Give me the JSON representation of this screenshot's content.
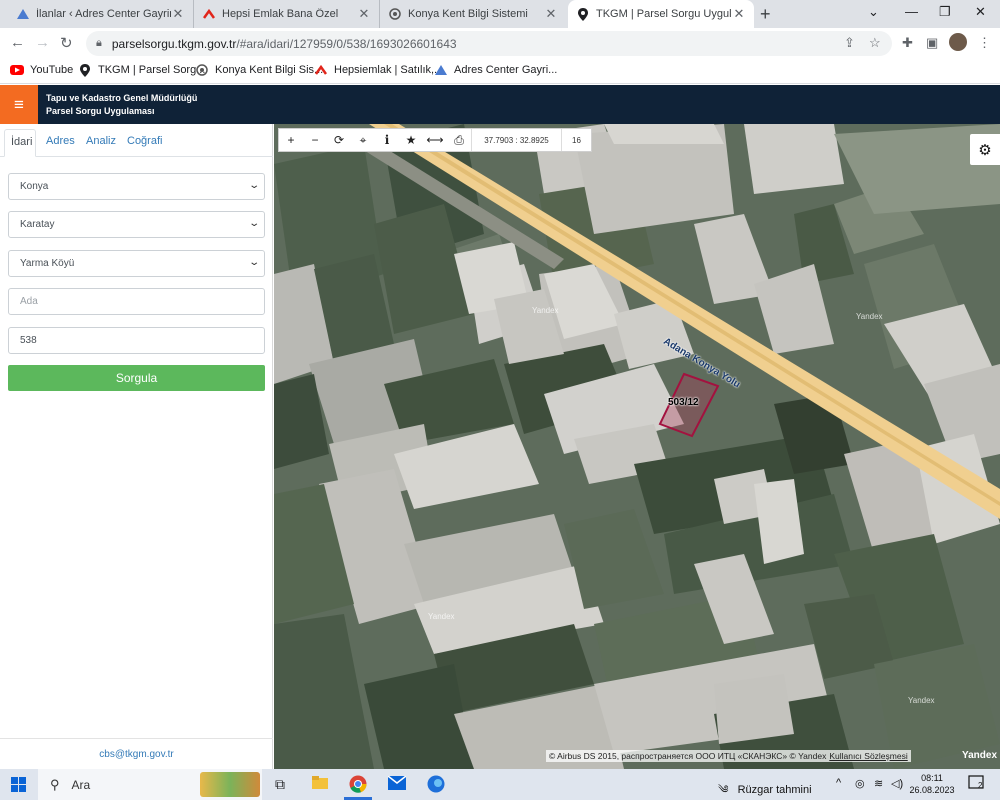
{
  "browser": {
    "tabs": [
      {
        "title": "İlanlar ‹ Adres Center Gayrimenkul",
        "icon": "adres-center-icon",
        "active": false
      },
      {
        "title": "Hepsi Emlak Bana Özel",
        "icon": "hepsiemlak-icon",
        "active": false
      },
      {
        "title": "Konya Kent Bilgi Sistemi",
        "icon": "konya-kbs-icon",
        "active": false
      },
      {
        "title": "TKGM | Parsel Sorgu Uygulaması",
        "icon": "map-pin-icon",
        "active": true
      }
    ],
    "url_domain": "parselsorgu.tkgm.gov.tr",
    "url_path": "/#ara/idari/127959/0/538/1693026601643",
    "bookmarks": [
      {
        "label": "YouTube",
        "icon": "youtube-icon"
      },
      {
        "label": "TKGM | Parsel Sorg...",
        "icon": "map-pin-icon"
      },
      {
        "label": "Konya Kent Bilgi Sis...",
        "icon": "konya-kbs-icon"
      },
      {
        "label": "Hepsiemlak | Satılık,...",
        "icon": "hepsiemlak-icon"
      },
      {
        "label": "Adres Center Gayri...",
        "icon": "adres-center-icon"
      }
    ]
  },
  "app": {
    "title_line1": "Tapu ve Kadastro Genel Müdürlüğü",
    "title_line2": "Parsel Sorgu Uygulaması",
    "accent": "#f36b21",
    "header_bg": "#0f2237"
  },
  "panel": {
    "tabs": [
      "İdari",
      "Adres",
      "Analiz",
      "Coğrafi"
    ],
    "province": "Konya",
    "district": "Karatay",
    "neighborhood": "Yarma Köyü",
    "ada_placeholder": "Ada",
    "parsel_value": "538",
    "submit_label": "Sorgula",
    "submit_color": "#5cb85c",
    "footer_email": "cbs@tkgm.gov.tr"
  },
  "map": {
    "coordinates": "37.7903 : 32.8925",
    "zoom": "16",
    "road_label": "Adana Konya Yolu",
    "parcel_label": "503/12",
    "watermark": "Yandex",
    "attribution": "© Airbus DS 2015, распространяется ООО ИТЦ «СКАНЭКС» © Yandex",
    "attribution_link": "Kullanıcı Sözleşmesi",
    "logo": "Yandex"
  },
  "taskbar": {
    "search_label": "Ara",
    "weather": "Rüzgar tahmini",
    "time": "08:11",
    "date": "26.08.2023",
    "notifications": "2"
  }
}
